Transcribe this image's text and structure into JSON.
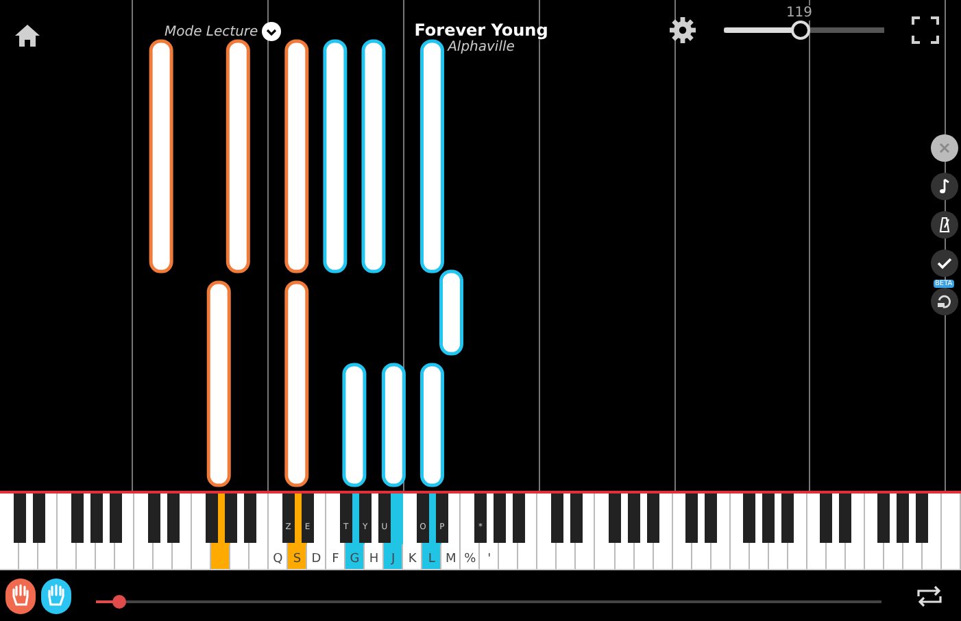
{
  "header": {
    "mode": "Mode Lecture",
    "song_title": "Forever Young",
    "artist": "Alphaville",
    "tempo": {
      "reading": "119",
      "level": 0.47
    }
  },
  "side_tools": [
    {
      "kind": "close"
    },
    {
      "kind": "note"
    },
    {
      "kind": "metronome"
    },
    {
      "kind": "check"
    },
    {
      "kind": "loop",
      "badge": "BETA"
    }
  ],
  "keyboard": {
    "white_keys": [
      {
        "pressed": false
      },
      {
        "pressed": false
      },
      {
        "pressed": false
      },
      {
        "pressed": false
      },
      {
        "pressed": false
      },
      {
        "pressed": false
      },
      {
        "pressed": false
      },
      {
        "pressed": false
      },
      {
        "pressed": false
      },
      {
        "pressed": false
      },
      {
        "pressed": false
      },
      {
        "pressed": true,
        "color": "#ffaa00"
      },
      {
        "pressed": false
      },
      {
        "pressed": false
      },
      {
        "label": "Q",
        "pressed": false
      },
      {
        "label": "S",
        "pressed": true,
        "color": "#ffaa00"
      },
      {
        "label": "D",
        "pressed": false
      },
      {
        "label": "F",
        "pressed": false
      },
      {
        "label": "G",
        "pressed": true,
        "color": "#22c4e6"
      },
      {
        "label": "H",
        "pressed": false
      },
      {
        "label": "J",
        "pressed": true,
        "color": "#22c4e6"
      },
      {
        "label": "K",
        "pressed": false
      },
      {
        "label": "L",
        "pressed": true,
        "color": "#22c4e6"
      },
      {
        "label": "M",
        "pressed": false
      },
      {
        "label": "%",
        "pressed": false
      },
      {
        "label": "'",
        "pressed": false
      },
      {
        "pressed": false
      },
      {
        "pressed": false
      },
      {
        "pressed": false
      },
      {
        "pressed": false
      },
      {
        "pressed": false
      },
      {
        "pressed": false
      },
      {
        "pressed": false
      },
      {
        "pressed": false
      },
      {
        "pressed": false
      },
      {
        "pressed": false
      },
      {
        "pressed": false
      },
      {
        "pressed": false
      },
      {
        "pressed": false
      },
      {
        "pressed": false
      },
      {
        "pressed": false
      },
      {
        "pressed": false
      },
      {
        "pressed": false
      },
      {
        "pressed": false
      },
      {
        "pressed": false
      },
      {
        "pressed": false
      },
      {
        "pressed": false
      },
      {
        "pressed": false
      },
      {
        "pressed": false
      },
      {
        "pressed": false
      }
    ],
    "black_keys": [
      {
        "pressed": false
      },
      {
        "pressed": false
      },
      {
        "pressed": false
      },
      {
        "pressed": false
      },
      {
        "pressed": false
      },
      {
        "pressed": false
      },
      {
        "pressed": false
      },
      {
        "pressed": false
      },
      {
        "pressed": false
      },
      {
        "pressed": false
      },
      {
        "label": "Z",
        "pressed": false
      },
      {
        "label": "E",
        "pressed": false
      },
      {
        "label": "T",
        "pressed": false
      },
      {
        "label": "Y",
        "pressed": false
      },
      {
        "label": "U",
        "pressed": false
      },
      {
        "label": "O",
        "pressed": false
      },
      {
        "label": "P",
        "pressed": false
      },
      {
        "label": "*",
        "pressed": false
      },
      {
        "pressed": false
      },
      {
        "pressed": false
      },
      {
        "pressed": false
      },
      {
        "pressed": false
      },
      {
        "pressed": false
      },
      {
        "pressed": false
      },
      {
        "pressed": false
      },
      {
        "pressed": false
      },
      {
        "pressed": false
      },
      {
        "pressed": false
      },
      {
        "pressed": false
      },
      {
        "pressed": false
      },
      {
        "pressed": false
      },
      {
        "pressed": false
      },
      {
        "pressed": false
      },
      {
        "pressed": false
      },
      {
        "pressed": false
      }
    ]
  },
  "footer": {
    "hands": [
      {
        "kind": "left",
        "selected": true,
        "color": "#f06a4f"
      },
      {
        "kind": "right",
        "selected": true,
        "color": "#2cc4f0"
      }
    ],
    "progress": {
      "level": 0.03
    }
  }
}
